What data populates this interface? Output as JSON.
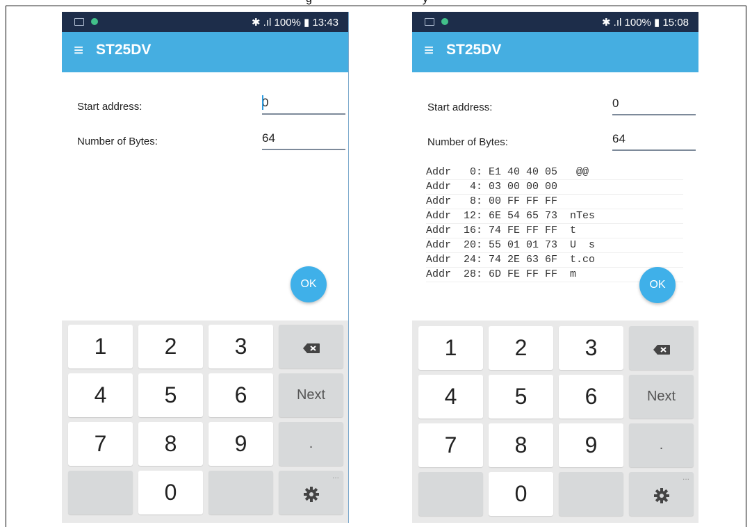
{
  "caption_fragments": [
    "g",
    "y"
  ],
  "screens": [
    {
      "status": {
        "right_text": "✱ .ıl 100% ▮ 13:43"
      },
      "appbar": {
        "menu_glyph": "≡",
        "title": "ST25DV"
      },
      "form": {
        "start_label": "Start address:",
        "start_value": "0",
        "bytes_label": "Number of Bytes:",
        "bytes_value": "64"
      },
      "ok_label": "OK",
      "dump": []
    },
    {
      "status": {
        "right_text": "✱ .ıl 100% ▮ 15:08"
      },
      "appbar": {
        "menu_glyph": "≡",
        "title": "ST25DV"
      },
      "form": {
        "start_label": "Start address:",
        "start_value": "0",
        "bytes_label": "Number of Bytes:",
        "bytes_value": "64"
      },
      "ok_label": "OK",
      "dump": [
        "Addr   0: E1 40 40 05   @@",
        "Addr   4: 03 00 00 00",
        "Addr   8: 00 FF FF FF",
        "Addr  12: 6E 54 65 73  nTes",
        "Addr  16: 74 FE FF FF  t",
        "Addr  20: 55 01 01 73  U  s",
        "Addr  24: 74 2E 63 6F  t.co",
        "Addr  28: 6D FE FF FF  m"
      ]
    }
  ],
  "keyboard": {
    "keys": [
      "1",
      "2",
      "3",
      "4",
      "5",
      "6",
      "7",
      "8",
      "9",
      "0"
    ],
    "backspace_icon": "backspace-icon",
    "next_label": "Next",
    "period_label": ".",
    "settings_icon": "gear-icon",
    "more_indicator": "..."
  }
}
